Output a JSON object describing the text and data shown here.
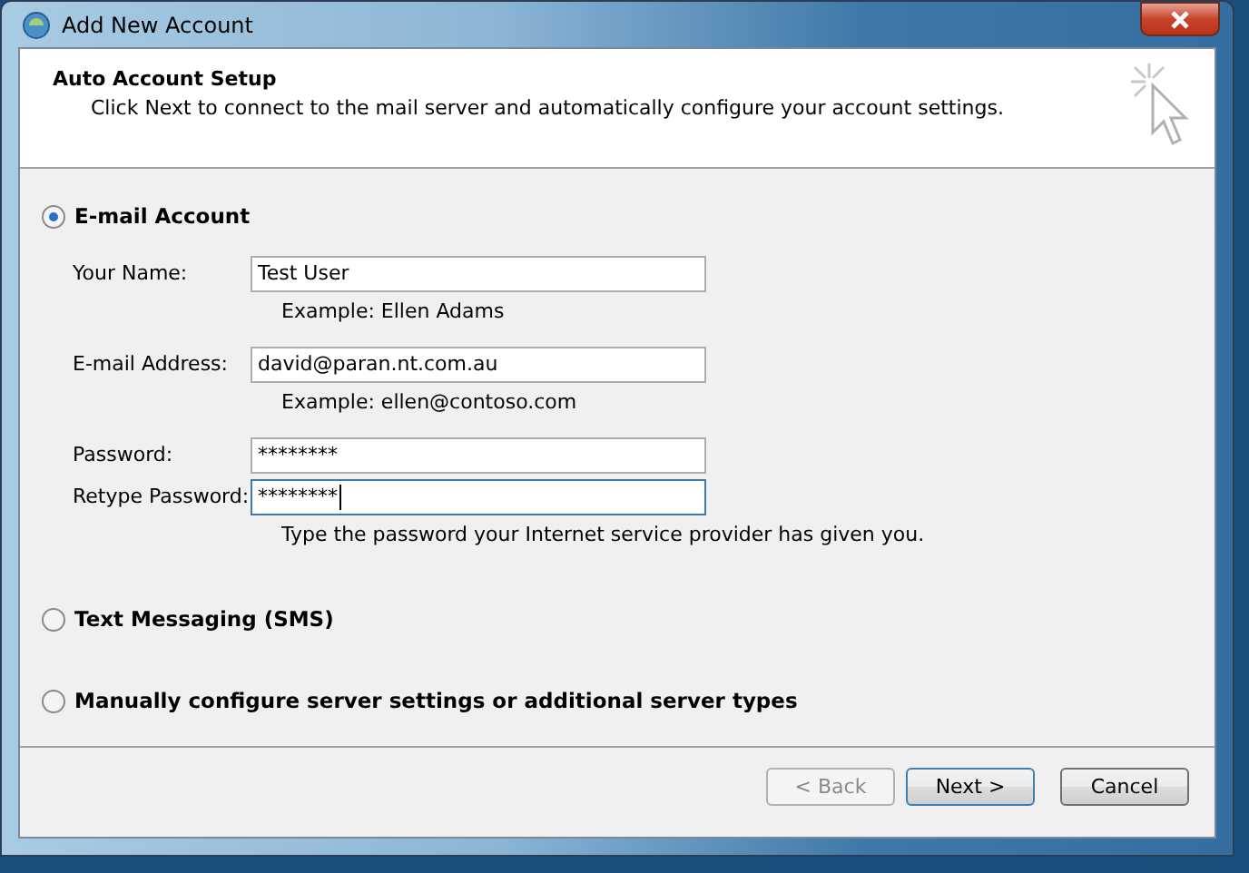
{
  "window": {
    "title": "Add New Account"
  },
  "header": {
    "title": "Auto Account Setup",
    "subtitle": "Click Next to connect to the mail server and automatically configure your account settings."
  },
  "options": [
    {
      "label": "E-mail Account",
      "selected": true,
      "fields": [
        {
          "label": "Your Name:",
          "value": "Test User",
          "hint": "Example: Ellen Adams",
          "focused": false
        },
        {
          "label": "E-mail Address:",
          "value": "david@paran.nt.com.au",
          "hint": "Example: ellen@contoso.com",
          "focused": false
        },
        {
          "label": "Password:",
          "value": "********",
          "focused": false
        },
        {
          "label": "Retype Password:",
          "value": "********",
          "hint": "Type the password your Internet service provider has given you.",
          "focused": true
        }
      ]
    },
    {
      "label": "Text Messaging (SMS)",
      "selected": false
    },
    {
      "label": "Manually configure server settings or additional server types",
      "selected": false
    }
  ],
  "buttons": [
    {
      "label": "< Back",
      "disabled": true,
      "default": false
    },
    {
      "label": "Next >",
      "disabled": false,
      "default": true
    },
    {
      "label": "Cancel",
      "disabled": false,
      "default": false
    }
  ]
}
